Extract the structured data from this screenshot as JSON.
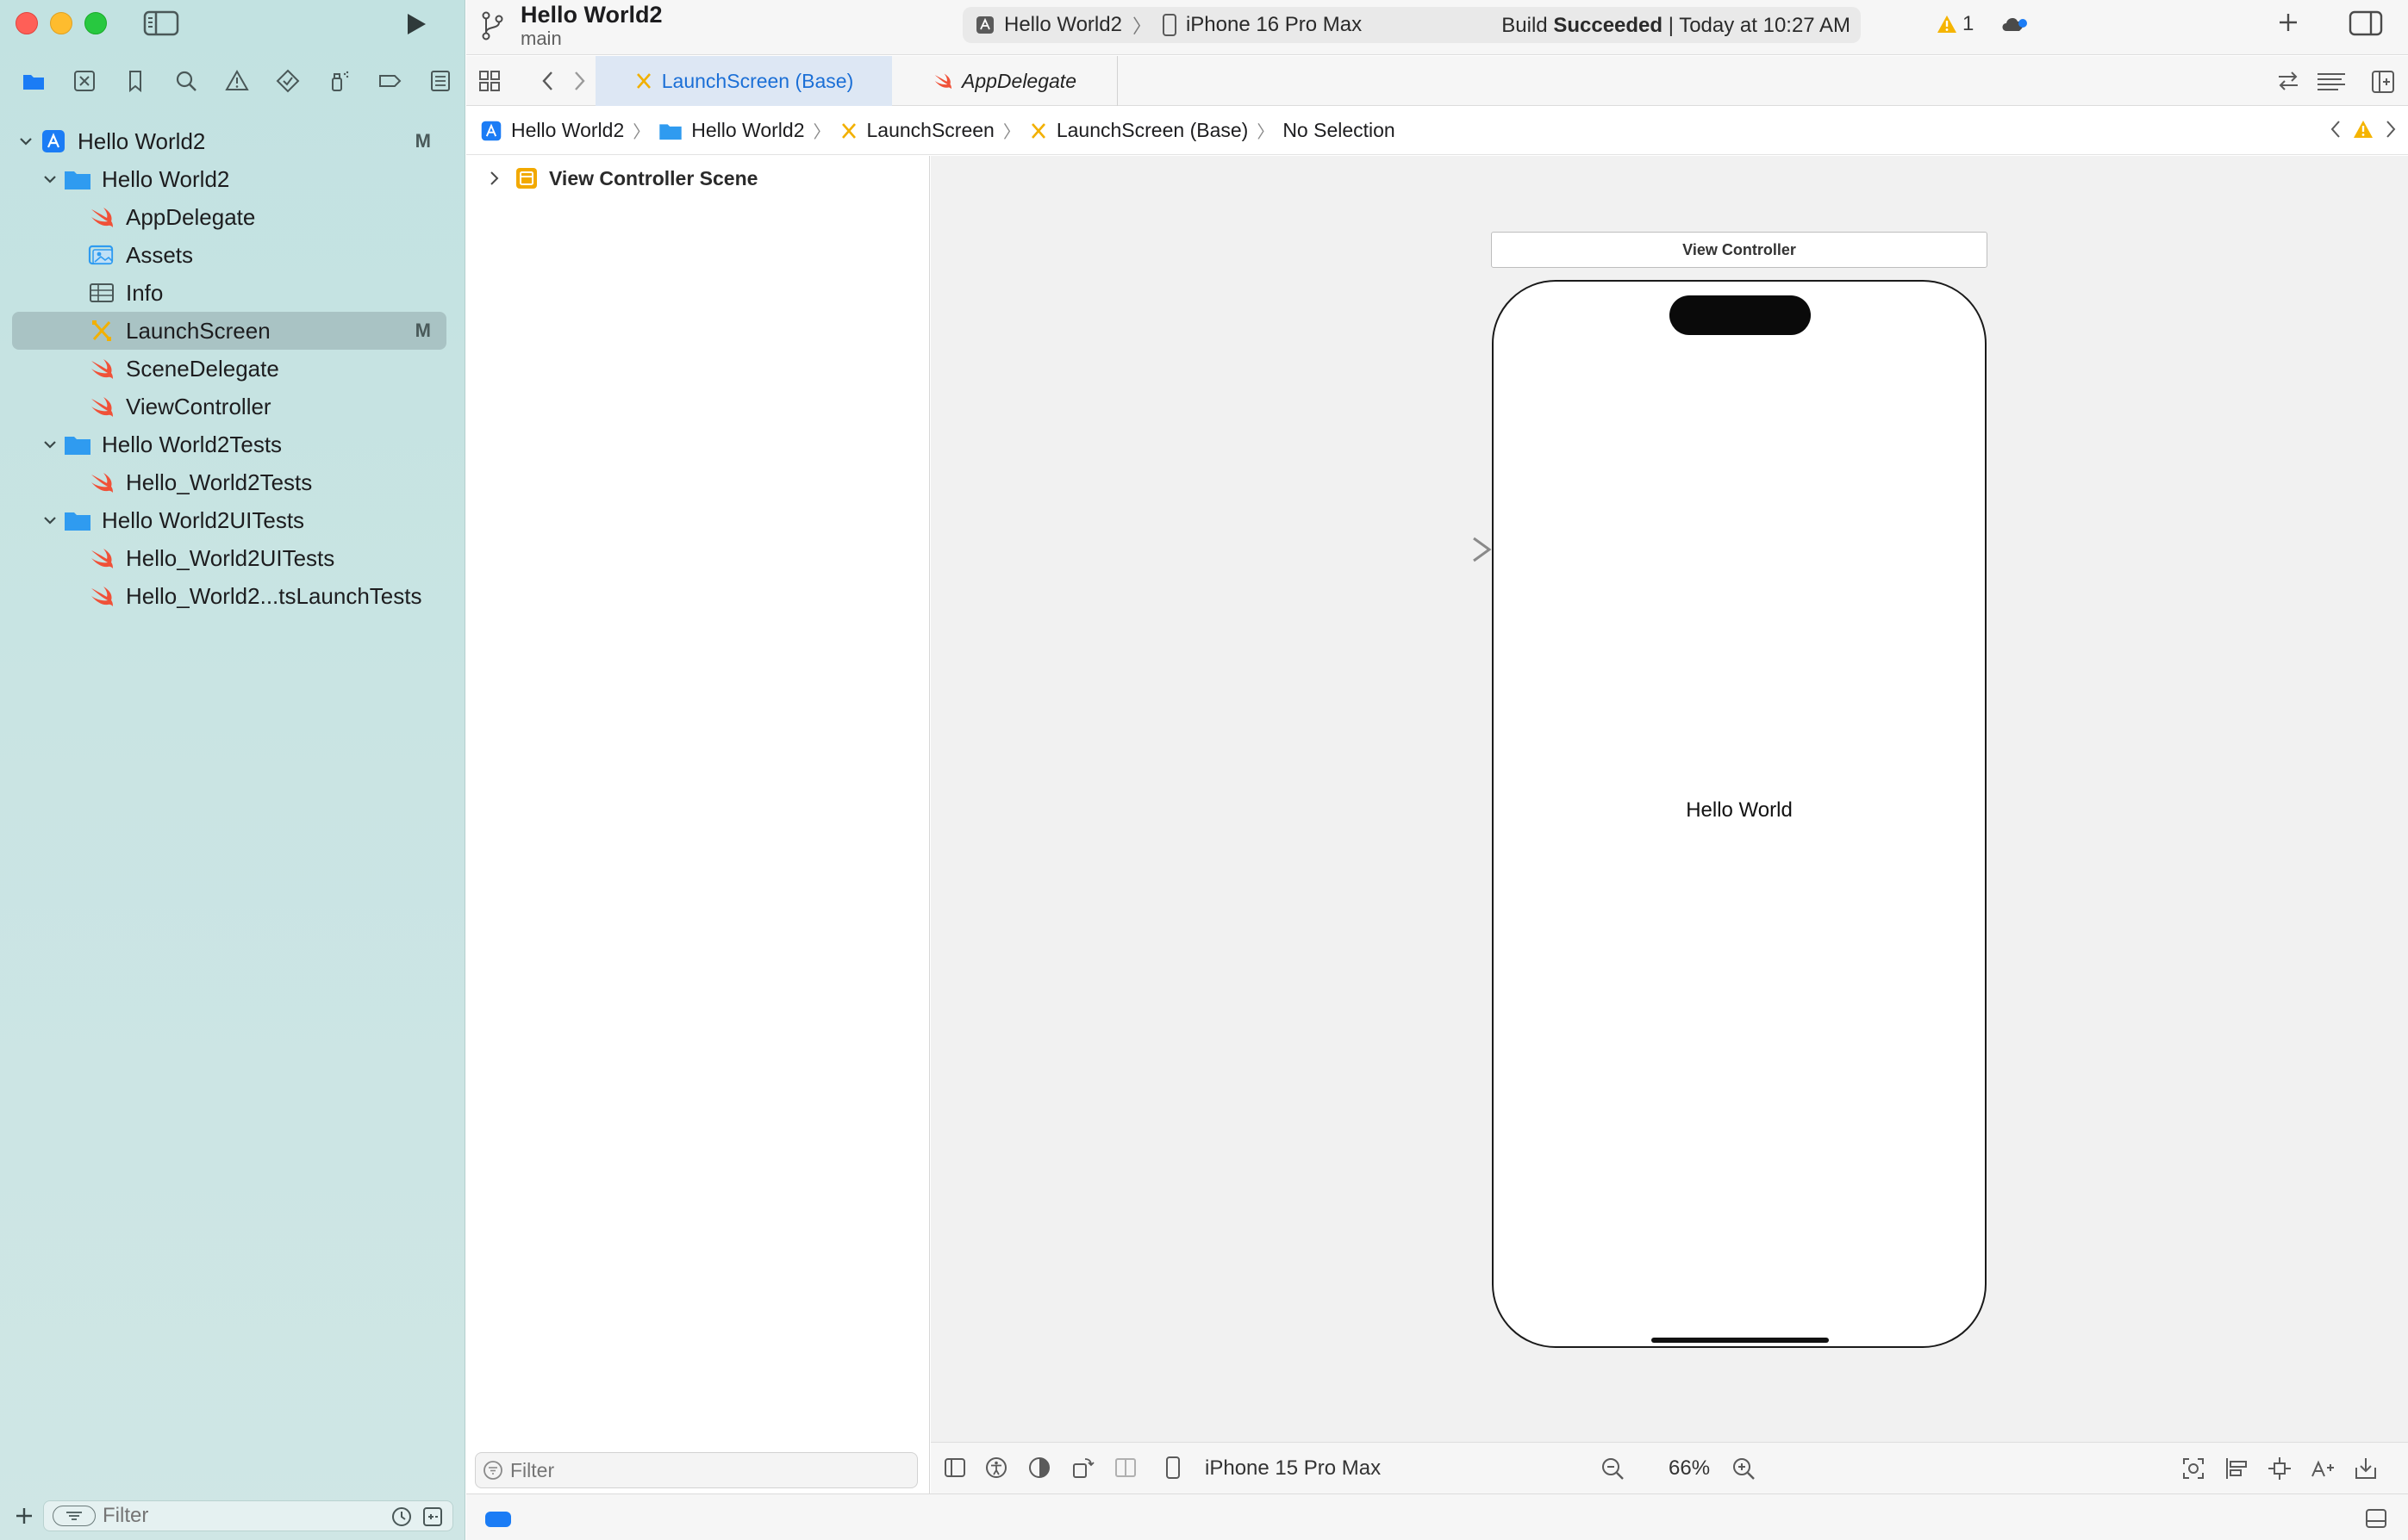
{
  "toolbar": {
    "project_title": "Hello World2",
    "branch": "main",
    "scheme": "Hello World2",
    "destination": "iPhone 16 Pro Max",
    "build_prefix": "Build",
    "build_status": "Succeeded",
    "build_time": "| Today at 10:27 AM",
    "warning_count": "1"
  },
  "navigator": {
    "tree": [
      {
        "label": "Hello World2",
        "badge": "M"
      },
      {
        "label": "Hello World2"
      },
      {
        "label": "AppDelegate"
      },
      {
        "label": "Assets"
      },
      {
        "label": "Info"
      },
      {
        "label": "LaunchScreen",
        "badge": "M"
      },
      {
        "label": "SceneDelegate"
      },
      {
        "label": "ViewController"
      },
      {
        "label": "Hello World2Tests"
      },
      {
        "label": "Hello_World2Tests"
      },
      {
        "label": "Hello World2UITests"
      },
      {
        "label": "Hello_World2UITests"
      },
      {
        "label": "Hello_World2...tsLaunchTests"
      }
    ],
    "filter_placeholder": "Filter"
  },
  "tabs": [
    {
      "label": "LaunchScreen (Base)"
    },
    {
      "label": "AppDelegate"
    }
  ],
  "breadcrumb": [
    "Hello World2",
    "Hello World2",
    "LaunchScreen",
    "LaunchScreen (Base)",
    "No Selection"
  ],
  "outline": {
    "scene": "View Controller Scene",
    "filter_placeholder": "Filter"
  },
  "canvas": {
    "vc_title": "View Controller",
    "label_text": "Hello World",
    "device": "iPhone 15 Pro Max",
    "zoom": "66%"
  },
  "colors": {
    "accent": "#1b7cf5",
    "swift": "#f05138",
    "storyboard": "#f2b000",
    "warning": "#f5b400",
    "folder": "#2f9bf0"
  }
}
